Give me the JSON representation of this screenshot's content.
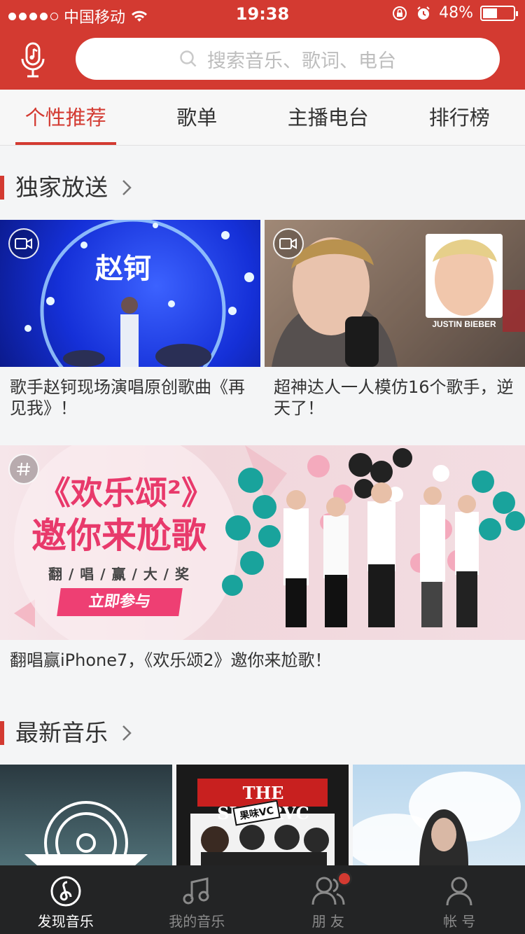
{
  "status": {
    "carrier": "中国移动",
    "time": "19:38",
    "battery": "48%",
    "battery_level": 0.48
  },
  "search": {
    "placeholder": "搜索音乐、歌词、电台"
  },
  "tabs": [
    {
      "label": "个性推荐"
    },
    {
      "label": "歌单"
    },
    {
      "label": "主播电台"
    },
    {
      "label": "排行榜"
    }
  ],
  "exclusive": {
    "title": "独家放送",
    "cards": [
      {
        "caption": "歌手赵钶现场演唱原创歌曲《再见我》！",
        "overlay_text": "赵钶"
      },
      {
        "caption": "超神达人一人模仿16个歌手，逆天了！",
        "overlay_text": "JUSTIN BIEBER"
      }
    ],
    "banner": {
      "caption": "翻唱赢iPhone7，《欢乐颂2》邀你来尬歌！",
      "title_line1": "《欢乐颂²》",
      "title_line2": "邀你来尬歌",
      "tagline": "翻 / 唱 / 赢 / 大 / 奖",
      "button": "立即参与"
    }
  },
  "newest": {
    "title": "最新音乐",
    "album2_text": "THE SUPERVC",
    "album2_sticker": "果味VC"
  },
  "nav": [
    {
      "label": "发现音乐",
      "icon": "netease-music-icon",
      "active": true
    },
    {
      "label": "我的音乐",
      "icon": "music-note-icon",
      "active": false
    },
    {
      "label": "朋 友",
      "icon": "friends-icon",
      "active": false,
      "badge": true
    },
    {
      "label": "帐 号",
      "icon": "person-icon",
      "active": false
    }
  ],
  "colors": {
    "brand": "#d33a31",
    "nav_bg": "#232425"
  }
}
